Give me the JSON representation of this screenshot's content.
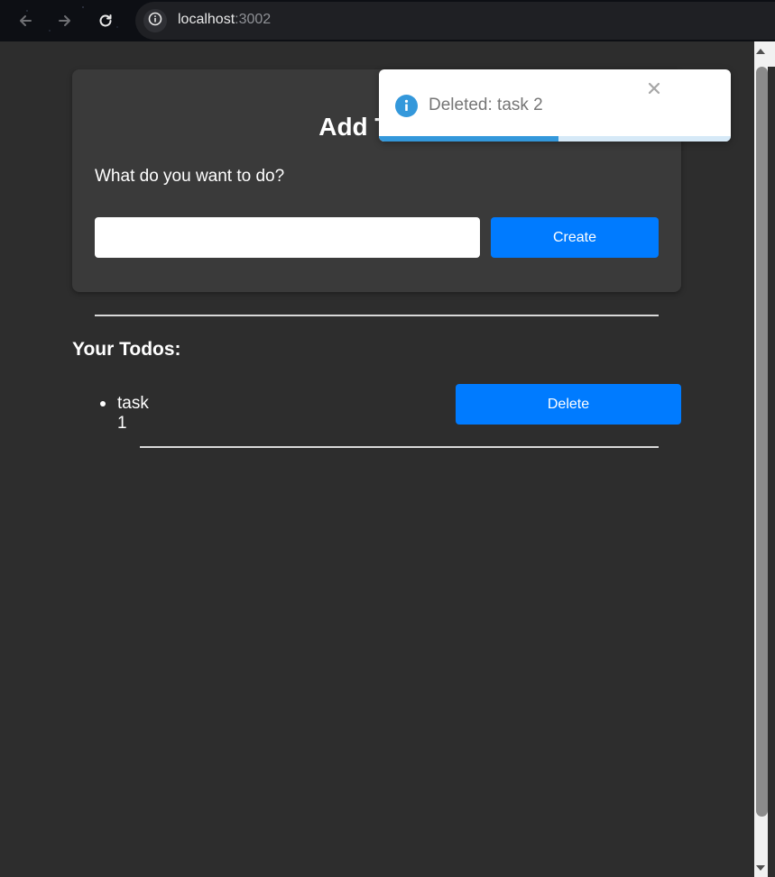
{
  "browser": {
    "url_host": "localhost",
    "url_port": ":3002",
    "back_icon": "arrow-left-icon",
    "forward_icon": "arrow-right-icon",
    "reload_icon": "reload-icon",
    "info_icon": "info-icon"
  },
  "add_card": {
    "title": "Add Todo",
    "question": "What do you want to do?",
    "input_value": "",
    "input_placeholder": "",
    "create_label": "Create"
  },
  "todos": {
    "heading": "Your Todos:",
    "items": [
      {
        "text": "task 1",
        "delete_label": "Delete"
      }
    ]
  },
  "toast": {
    "message": "Deleted: task 2",
    "icon": "info-icon",
    "close_icon": "close-icon",
    "progress_fraction": 0.51,
    "color": "#3498db"
  },
  "colors": {
    "page_background": "#2d2d2d",
    "card_background": "#3a3a3a",
    "primary_button": "#007bff"
  }
}
